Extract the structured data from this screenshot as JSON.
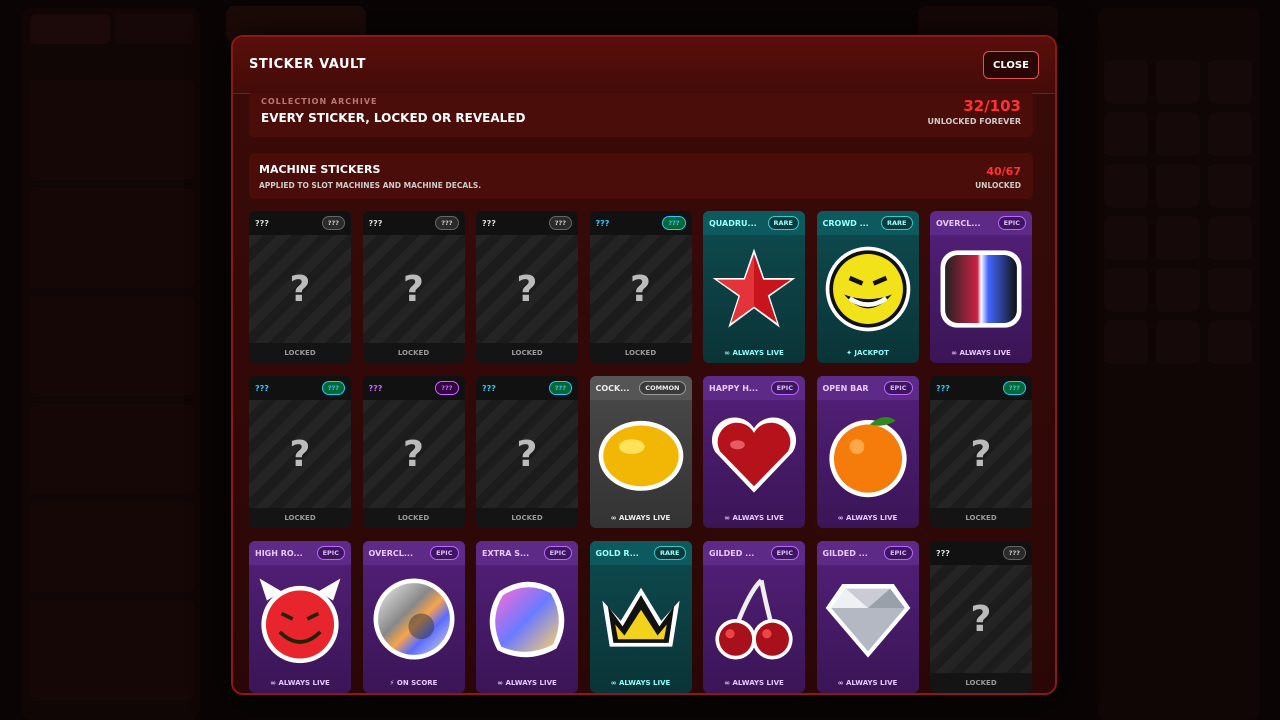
{
  "modal": {
    "title": "STICKER VAULT",
    "close_label": "CLOSE"
  },
  "archive": {
    "label": "COLLECTION ARCHIVE",
    "headline": "EVERY STICKER, LOCKED OR REVEALED",
    "count": "32/103",
    "sub": "UNLOCKED FOREVER"
  },
  "section": {
    "title": "MACHINE STICKERS",
    "desc": "APPLIED TO SLOT MACHINES AND MACHINE DECALS.",
    "count": "40/67",
    "sub": "UNLOCKED"
  },
  "stickers": [
    {
      "name": "???",
      "rarity": "???",
      "status": "LOCKED",
      "tier": "locked",
      "art": "question"
    },
    {
      "name": "???",
      "rarity": "???",
      "status": "LOCKED",
      "tier": "locked",
      "art": "question"
    },
    {
      "name": "???",
      "rarity": "???",
      "status": "LOCKED",
      "tier": "locked",
      "art": "question"
    },
    {
      "name": "???",
      "rarity": "???",
      "status": "LOCKED",
      "tier": "locked-cyan",
      "art": "question"
    },
    {
      "name": "QUADRU...",
      "rarity": "RARE",
      "status": "∞ ALWAYS LIVE",
      "tier": "rare",
      "art": "star"
    },
    {
      "name": "CROWD ...",
      "rarity": "RARE",
      "status": "✦ JACKPOT",
      "tier": "rare",
      "art": "smiley"
    },
    {
      "name": "OVERCL...",
      "rarity": "EPIC",
      "status": "∞ ALWAYS LIVE",
      "tier": "epic",
      "art": "holo"
    },
    {
      "name": "???",
      "rarity": "???",
      "status": "LOCKED",
      "tier": "locked-cyan",
      "art": "question"
    },
    {
      "name": "???",
      "rarity": "???",
      "status": "LOCKED",
      "tier": "locked-purple",
      "art": "question"
    },
    {
      "name": "???",
      "rarity": "???",
      "status": "LOCKED",
      "tier": "locked-cyan",
      "art": "question"
    },
    {
      "name": "COCK...",
      "rarity": "COMMON",
      "status": "∞ ALWAYS LIVE",
      "tier": "common",
      "art": "lemon"
    },
    {
      "name": "HAPPY H...",
      "rarity": "EPIC",
      "status": "∞ ALWAYS LIVE",
      "tier": "epic",
      "art": "heart"
    },
    {
      "name": "OPEN BAR",
      "rarity": "EPIC",
      "status": "∞ ALWAYS LIVE",
      "tier": "epic",
      "art": "orange"
    },
    {
      "name": "???",
      "rarity": "???",
      "status": "LOCKED",
      "tier": "locked-cyan",
      "art": "question"
    },
    {
      "name": "HIGH RO...",
      "rarity": "EPIC",
      "status": "∞ ALWAYS LIVE",
      "tier": "epic",
      "art": "devil"
    },
    {
      "name": "OVERCL...",
      "rarity": "EPIC",
      "status": "⚡ ON SCORE",
      "tier": "epic",
      "art": "chrome"
    },
    {
      "name": "EXTRA S...",
      "rarity": "EPIC",
      "status": "∞ ALWAYS LIVE",
      "tier": "epic",
      "art": "blob"
    },
    {
      "name": "GOLD R...",
      "rarity": "RARE",
      "status": "∞ ALWAYS LIVE",
      "tier": "rare",
      "art": "crown"
    },
    {
      "name": "GILDED ...",
      "rarity": "EPIC",
      "status": "∞ ALWAYS LIVE",
      "tier": "epic",
      "art": "cherry"
    },
    {
      "name": "GILDED ...",
      "rarity": "EPIC",
      "status": "∞ ALWAYS LIVE",
      "tier": "epic",
      "art": "diamond"
    },
    {
      "name": "???",
      "rarity": "???",
      "status": "LOCKED",
      "tier": "locked",
      "art": "question"
    }
  ],
  "colors": {
    "accent": "#ff3333",
    "modal_bg": "#3a0b09",
    "rare": "#0e4b4f",
    "epic": "#54207a",
    "common": "#4a4a4a"
  }
}
